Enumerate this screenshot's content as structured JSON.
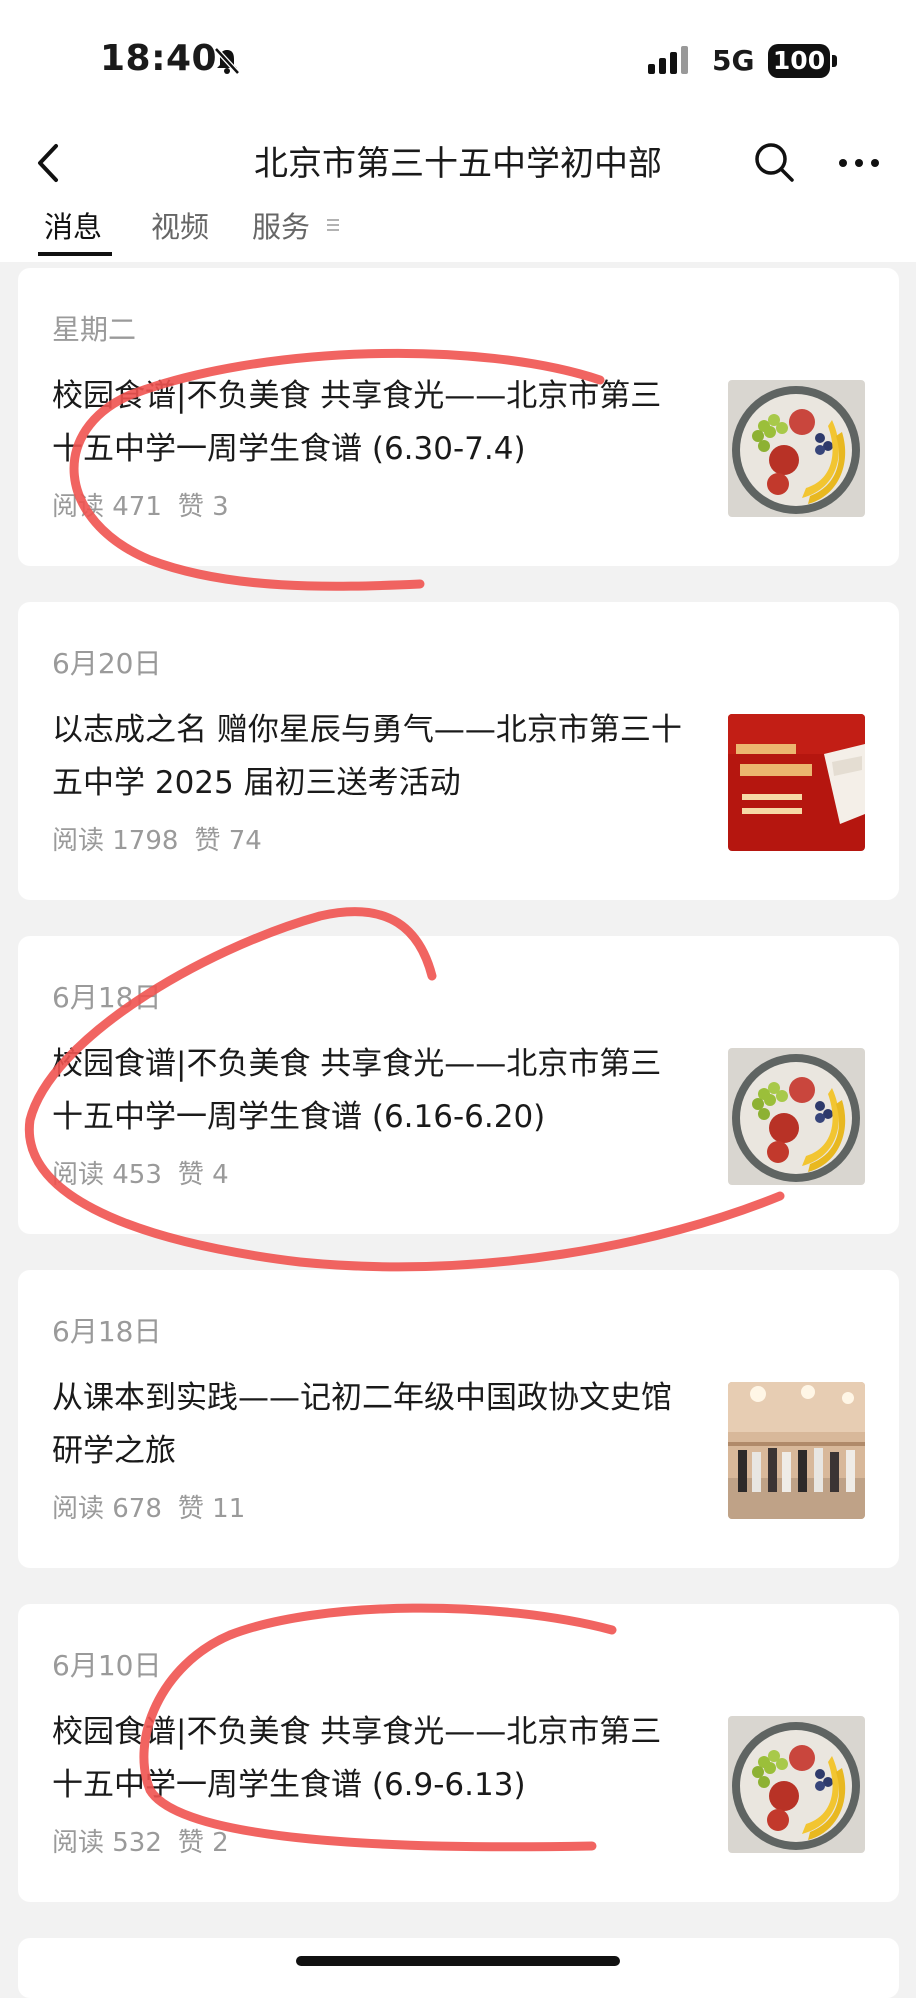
{
  "status_bar": {
    "time": "18:40",
    "network": "5G",
    "battery": "100"
  },
  "nav": {
    "title": "北京市第三十五中学初中部"
  },
  "tabs": [
    {
      "label": "消息"
    },
    {
      "label": "视频"
    },
    {
      "label": "服务"
    }
  ],
  "articles": [
    {
      "date": "星期二",
      "title": "校园食谱|不负美食 共享食光——北京市第三十五中学一周学生食谱 (6.30-7.4)",
      "reads": "阅读 471",
      "likes": "赞 3",
      "thumb": "fruit-plate"
    },
    {
      "date": "6月20日",
      "title": "以志成之名 赠你星辰与勇气——北京市第三十五中学 2025 届初三送考活动",
      "reads": "阅读 1798",
      "likes": "赞 74",
      "thumb": "red-poster"
    },
    {
      "date": "6月18日",
      "title": "校园食谱|不负美食 共享食光——北京市第三十五中学一周学生食谱 (6.16-6.20)",
      "reads": "阅读 453",
      "likes": "赞 4",
      "thumb": "fruit-plate"
    },
    {
      "date": "6月18日",
      "title": "从课本到实践——记初二年级中国政协文史馆研学之旅",
      "reads": "阅读 678",
      "likes": "赞 11",
      "thumb": "students-photo"
    },
    {
      "date": "6月10日",
      "title": "校园食谱|不负美食 共享食光——北京市第三十五中学一周学生食谱 (6.9-6.13)",
      "reads": "阅读 532",
      "likes": "赞 2",
      "thumb": "fruit-plate"
    }
  ],
  "colors": {
    "annotation": "#ef5350",
    "background": "#f2f2f2",
    "card": "#ffffff",
    "muted": "#9a9a9a"
  }
}
